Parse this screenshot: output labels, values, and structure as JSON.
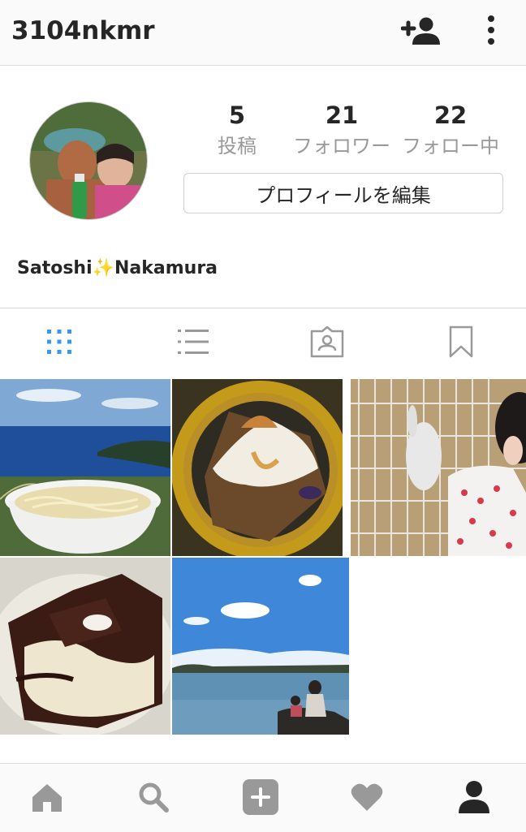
{
  "header": {
    "username": "3104nkmr"
  },
  "profile": {
    "stats": [
      {
        "count": "5",
        "label": "投稿"
      },
      {
        "count": "21",
        "label": "フォロワー"
      },
      {
        "count": "22",
        "label": "フォロー中"
      }
    ],
    "edit_button_label": "プロフィールを編集",
    "full_name": "Satoshi✨Nakamura"
  },
  "tabs": [
    {
      "icon": "grid-icon",
      "active": true
    },
    {
      "icon": "list-icon",
      "active": false
    },
    {
      "icon": "tagged-photos-icon",
      "active": false
    },
    {
      "icon": "bookmark-icon",
      "active": false
    }
  ],
  "posts": [
    {
      "subject": "bowl of noodles by the sea"
    },
    {
      "subject": "slice of cake with cream"
    },
    {
      "subject": "child feeding a rabbit in a cage"
    },
    {
      "subject": "chocolate and cream dessert"
    },
    {
      "subject": "lake shore with two people"
    }
  ],
  "bottom_nav": [
    {
      "icon": "home-icon"
    },
    {
      "icon": "search-icon"
    },
    {
      "icon": "add-post-icon"
    },
    {
      "icon": "heart-icon"
    },
    {
      "icon": "profile-icon",
      "active": true
    }
  ],
  "colors": {
    "accent": "#3897f0",
    "icon_gray": "#999999",
    "text": "#262626"
  }
}
